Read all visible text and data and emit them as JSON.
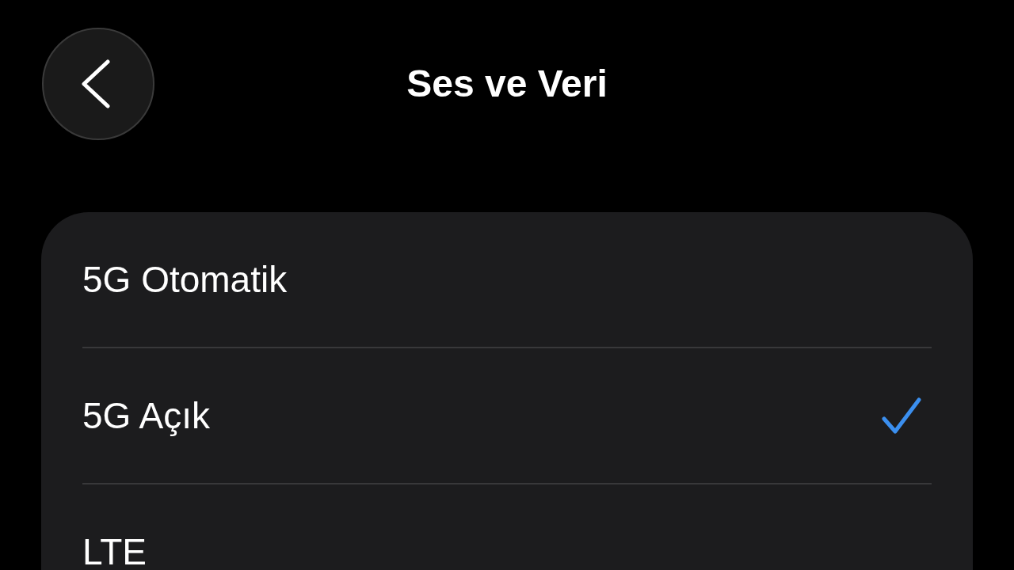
{
  "header": {
    "title": "Ses ve Veri"
  },
  "options": [
    {
      "label": "5G Otomatik",
      "selected": false
    },
    {
      "label": "5G Açık",
      "selected": true
    },
    {
      "label": "LTE",
      "selected": false
    }
  ]
}
